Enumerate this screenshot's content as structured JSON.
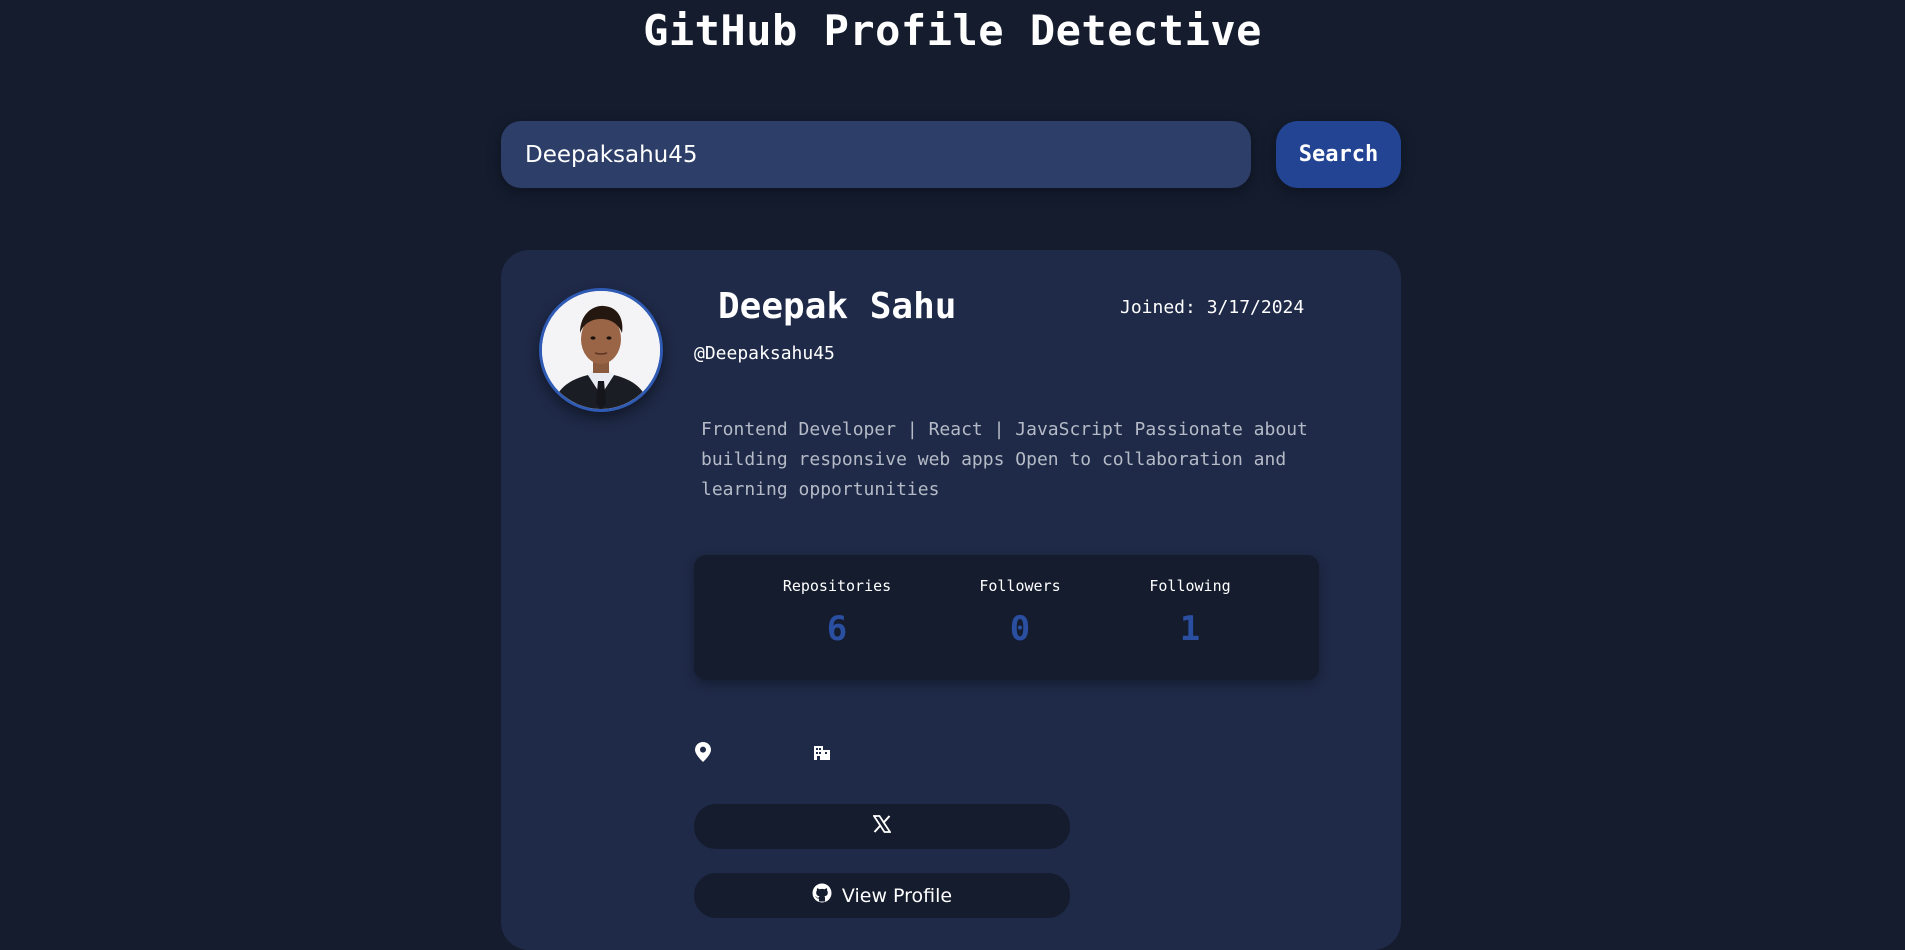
{
  "header": {
    "title": "GitHub Profile Detective"
  },
  "search": {
    "value": "Deepaksahu45",
    "button_label": "Search"
  },
  "profile": {
    "name": "Deepak Sahu",
    "username": "@Deepaksahu45",
    "joined": "Joined: 3/17/2024",
    "bio": "Frontend Developer | React | JavaScript Passionate about building responsive web apps Open to collaboration and learning opportunities",
    "avatar_icon": "user-photo"
  },
  "stats": [
    {
      "label": "Repositories",
      "value": "6"
    },
    {
      "label": "Followers",
      "value": "0"
    },
    {
      "label": "Following",
      "value": "1"
    }
  ],
  "meta": {
    "location_icon": "map-pin-icon",
    "company_icon": "building-icon"
  },
  "links": {
    "twitter_icon": "x-logo-icon",
    "view_profile_label": "View Profile",
    "view_profile_icon": "github-icon"
  },
  "colors": {
    "background": "#141c2e",
    "card": "#1f2a48",
    "input": "#2d3f69",
    "accent": "#234493",
    "stat_value": "#2a4ea0"
  }
}
